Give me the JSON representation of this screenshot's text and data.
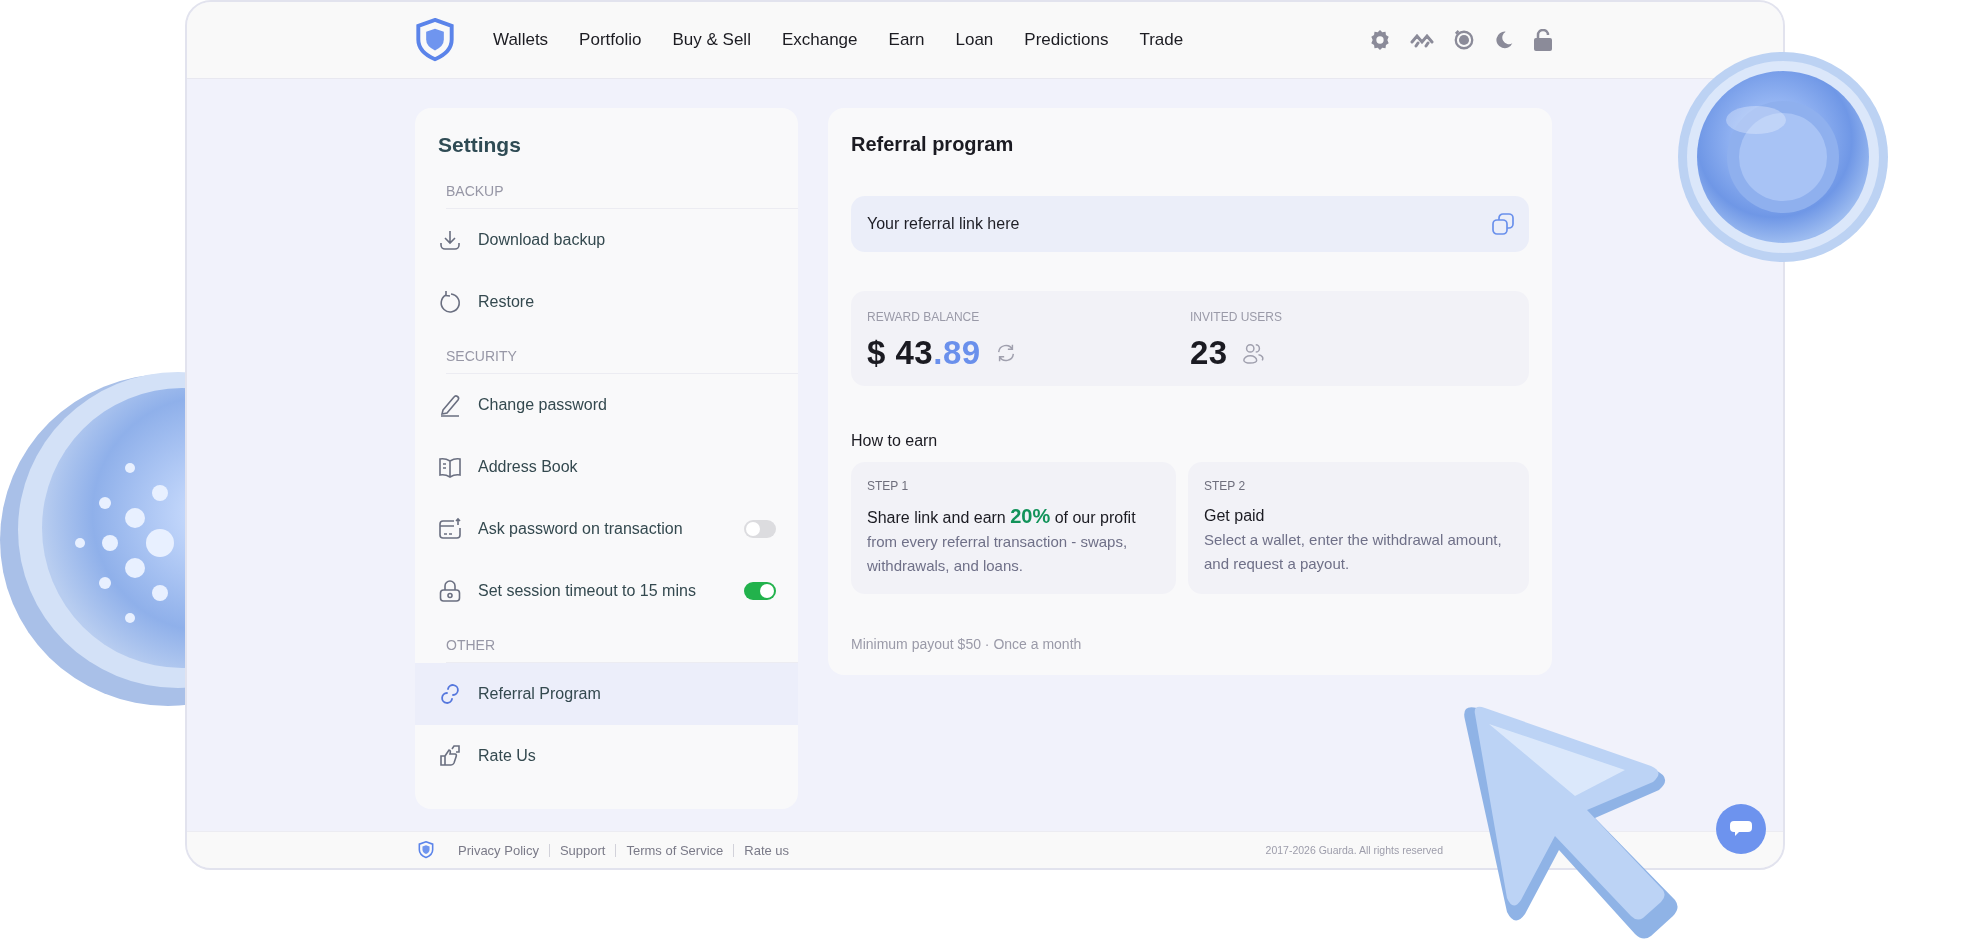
{
  "nav": {
    "items": [
      {
        "label": "Wallets"
      },
      {
        "label": "Portfolio"
      },
      {
        "label": "Buy & Sell"
      },
      {
        "label": "Exchange"
      },
      {
        "label": "Earn"
      },
      {
        "label": "Loan"
      },
      {
        "label": "Predictions"
      },
      {
        "label": "Trade"
      }
    ]
  },
  "sidebar": {
    "title": "Settings",
    "sections": [
      {
        "heading": "BACKUP",
        "items": [
          {
            "label": "Download backup",
            "kind": "link",
            "selected": false
          },
          {
            "label": "Restore",
            "kind": "link",
            "selected": false
          }
        ]
      },
      {
        "heading": "SECURITY",
        "items": [
          {
            "label": "Change password",
            "kind": "link",
            "selected": false
          },
          {
            "label": "Address Book",
            "kind": "link",
            "selected": false
          },
          {
            "label": "Ask password on transaction",
            "kind": "toggle",
            "on": false,
            "selected": false
          },
          {
            "label": "Set session timeout to 15 mins",
            "kind": "toggle",
            "on": true,
            "selected": false
          }
        ]
      },
      {
        "heading": "OTHER",
        "items": [
          {
            "label": "Referral Program",
            "kind": "link",
            "selected": true
          },
          {
            "label": "Rate Us",
            "kind": "link",
            "selected": false
          }
        ]
      }
    ]
  },
  "referral": {
    "title": "Referral program",
    "link_field": {
      "placeholder": "Your referral link here"
    },
    "stats": [
      {
        "label": "REWARD BALANCE",
        "value": "$ 43",
        "fraction": ".89"
      },
      {
        "label": "INVITED USERS",
        "value": "23"
      }
    ],
    "how_to_earn": {
      "title": "How to earn",
      "steps": [
        {
          "label": "STEP 1",
          "title": "Share link and earn **20%** of our profit",
          "text": "from every referral transaction - swaps, withdrawals, and loans."
        },
        {
          "label": "STEP 2",
          "title": "Get paid",
          "text": "Select a wallet, enter the withdrawal amount, and request a payout."
        }
      ]
    },
    "note": "Minimum payout $50 · Once a month"
  },
  "footer": {
    "links": [
      "Privacy Policy",
      "Support",
      "Terms of Service",
      "Rate us"
    ],
    "copyright": "2017-2026 Guarda. All rights reserved"
  }
}
